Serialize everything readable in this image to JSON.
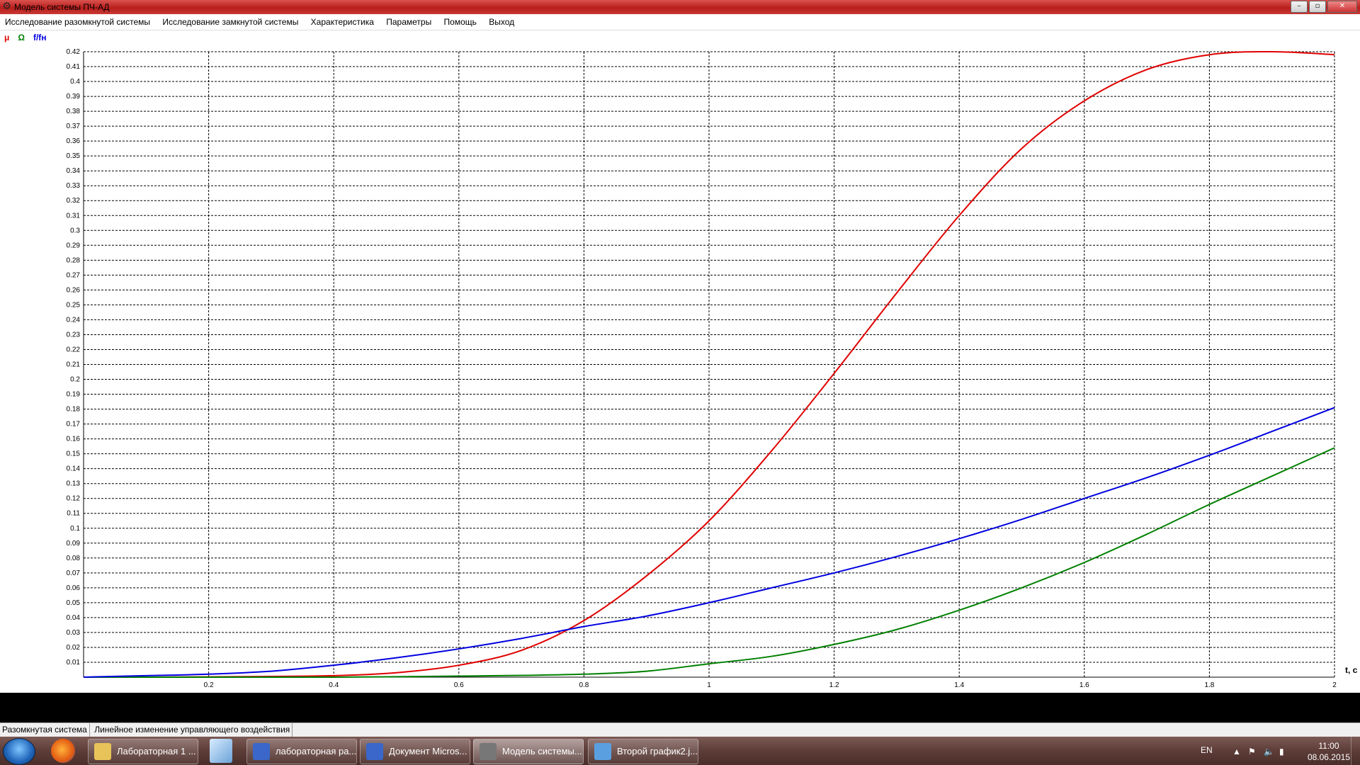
{
  "window": {
    "title": "Модель системы ПЧ-АД",
    "buttons": {
      "minimize": "–",
      "maximize": "▫",
      "close": "✕"
    }
  },
  "menu": [
    "Исследование разомкнутой системы",
    "Исследование замкнутой системы",
    "Характеристика",
    "Параметры",
    "Помощь",
    "Выход"
  ],
  "legend": [
    {
      "label": "μ",
      "color": "#e00000"
    },
    {
      "label": "Ω",
      "color": "#008000"
    },
    {
      "label": "f/fн",
      "color": "#0000e0"
    }
  ],
  "chart_data": {
    "type": "line",
    "xlabel": "t, c",
    "ylabel": "",
    "xlim": [
      0,
      2
    ],
    "ylim": [
      0,
      0.42
    ],
    "grid": true,
    "x_ticks": [
      "0.2",
      "0.4",
      "0.6",
      "0.8",
      "1",
      "1.2",
      "1.4",
      "1.6",
      "1.8",
      "2"
    ],
    "y_ticks": [
      "0.01",
      "0.02",
      "0.03",
      "0.04",
      "0.05",
      "0.06",
      "0.07",
      "0.08",
      "0.09",
      "0.1",
      "0.11",
      "0.12",
      "0.13",
      "0.14",
      "0.15",
      "0.16",
      "0.17",
      "0.18",
      "0.19",
      "0.2",
      "0.21",
      "0.22",
      "0.23",
      "0.24",
      "0.25",
      "0.26",
      "0.27",
      "0.28",
      "0.29",
      "0.3",
      "0.31",
      "0.32",
      "0.33",
      "0.34",
      "0.35",
      "0.36",
      "0.37",
      "0.38",
      "0.39",
      "0.4",
      "0.41",
      "0.42"
    ],
    "x": [
      0,
      0.1,
      0.2,
      0.3,
      0.4,
      0.5,
      0.6,
      0.7,
      0.8,
      0.9,
      1.0,
      1.1,
      1.2,
      1.3,
      1.4,
      1.5,
      1.6,
      1.7,
      1.8,
      1.9,
      2.0
    ],
    "series": [
      {
        "color": "#e00000",
        "values": [
          0,
          0,
          0.0002,
          0.0005,
          0.001,
          0.003,
          0.008,
          0.018,
          0.038,
          0.068,
          0.105,
          0.152,
          0.204,
          0.258,
          0.31,
          0.355,
          0.387,
          0.408,
          0.418,
          0.42,
          0.418
        ]
      },
      {
        "color": "#008000",
        "values": [
          0,
          0,
          0,
          0,
          0,
          0.0003,
          0.0007,
          0.0012,
          0.002,
          0.004,
          0.009,
          0.014,
          0.022,
          0.032,
          0.045,
          0.06,
          0.077,
          0.096,
          0.116,
          0.135,
          0.154
        ]
      },
      {
        "color": "#0000e0",
        "values": [
          0,
          0.001,
          0.002,
          0.004,
          0.008,
          0.013,
          0.019,
          0.026,
          0.034,
          0.041,
          0.05,
          0.06,
          0.07,
          0.081,
          0.093,
          0.106,
          0.12,
          0.134,
          0.149,
          0.165,
          0.181
        ]
      }
    ]
  },
  "status": {
    "mode": "Разомкнутая система",
    "description": "Линейное изменение управляющего воздействия"
  },
  "taskbar": {
    "items": [
      {
        "label": "Лабораторная 1 ...",
        "icon": "folder-icon",
        "color": "#e8c35a"
      },
      {
        "label": "лабораторная ра...",
        "icon": "word-icon",
        "color": "#3a67c9"
      },
      {
        "label": "Документ Micros...",
        "icon": "word-icon",
        "color": "#3a67c9"
      },
      {
        "label": "Модель системы...",
        "icon": "gear-icon",
        "color": "#777777"
      },
      {
        "label": "Второй график2.j...",
        "icon": "image-viewer-icon",
        "color": "#5aa0e0"
      }
    ],
    "tray": {
      "lang": "EN",
      "time": "11:00",
      "date": "08.06.2015"
    }
  }
}
